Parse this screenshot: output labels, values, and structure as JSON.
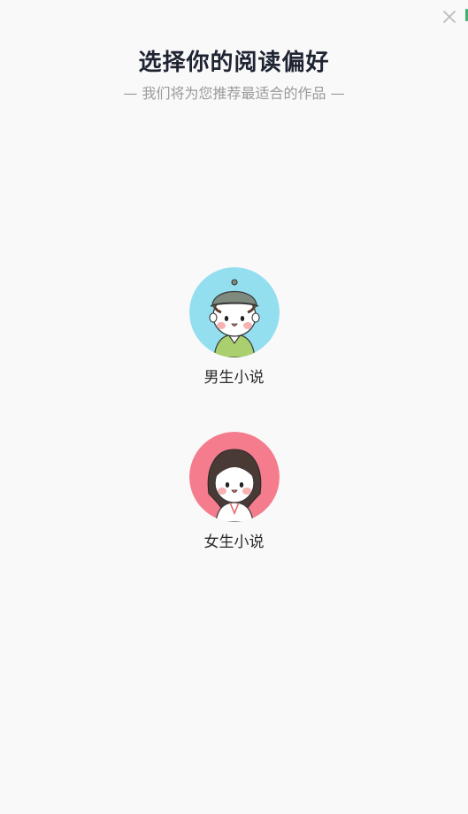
{
  "header": {
    "title": "选择你的阅读偏好",
    "subtitle": "— 我们将为您推荐最适合的作品 —"
  },
  "options": [
    {
      "label": "男生小说",
      "avatar": "boy-avatar-icon",
      "bg_color": "#93dff0"
    },
    {
      "label": "女生小说",
      "avatar": "girl-avatar-icon",
      "bg_color": "#f57c8c"
    }
  ],
  "icons": {
    "close": "close-icon"
  },
  "colors": {
    "title": "#1f2433",
    "subtitle": "#9a9a9a",
    "background": "#f9f9f9"
  }
}
